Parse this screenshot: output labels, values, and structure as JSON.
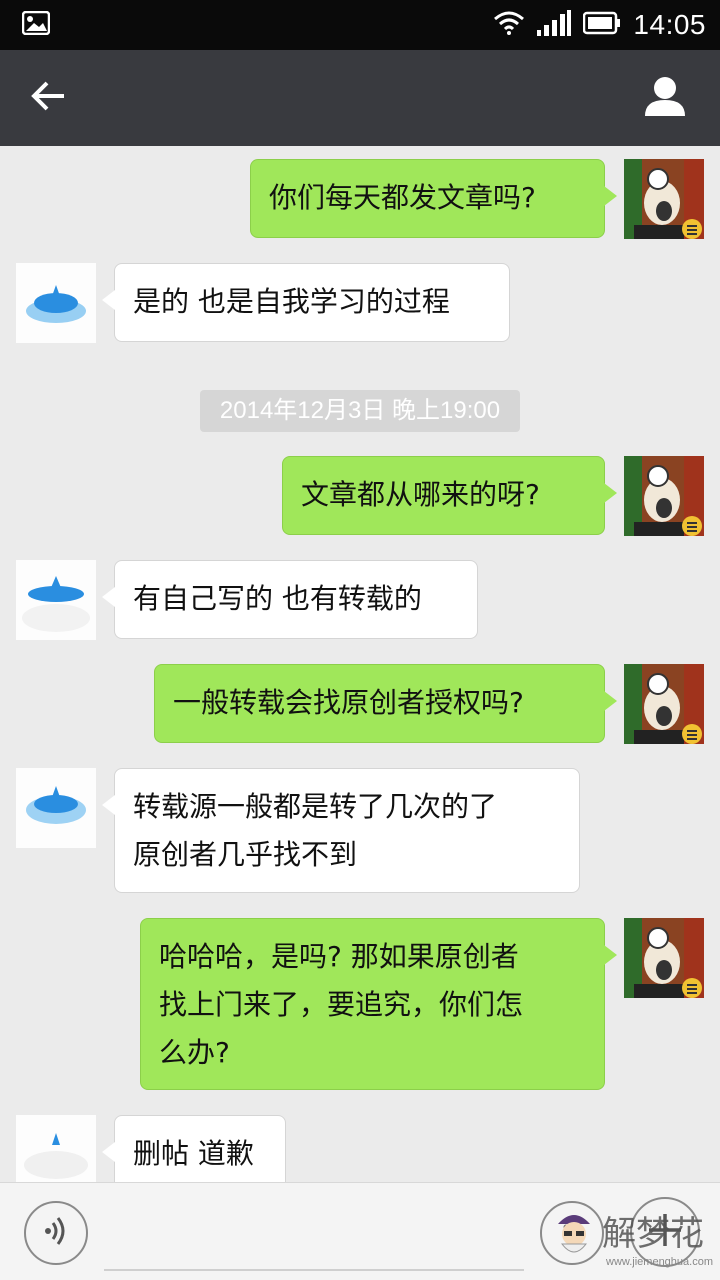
{
  "status_bar": {
    "time": "14:05"
  },
  "title_bar": {
    "back_icon": "arrow-left-icon",
    "profile_icon": "person-icon"
  },
  "messages": [
    {
      "side": "me",
      "text": "你们每天都发文章吗?"
    },
    {
      "side": "them",
      "text": "是的 也是自我学习的过程"
    },
    {
      "side": "me",
      "text": "文章都从哪来的呀?"
    },
    {
      "side": "them",
      "text": "有自己写的 也有转载的"
    },
    {
      "side": "me",
      "text": "一般转载会找原创者授权吗?"
    },
    {
      "side": "them",
      "lines": [
        "转载源一般都是转了几次的了",
        "原创者几乎找不到"
      ]
    },
    {
      "side": "me",
      "lines": [
        "哈哈哈，是吗? 那如果原创者",
        "找上门来了，要追究，你们怎",
        "么办?"
      ]
    },
    {
      "side": "them",
      "text": "删帖 道歉"
    }
  ],
  "timestamp": "2014年12月3日 晚上19:00",
  "input_bar": {
    "voice_icon": "voice-icon",
    "emoji_icon": "emoji-icon",
    "plus_icon": "plus-icon",
    "placeholder": ""
  },
  "watermark": {
    "text": "解梦花",
    "url": "www.jiemenghua.com"
  },
  "colors": {
    "me_bubble": "#a0e75a",
    "them_bubble": "#ffffff",
    "title_bar": "#393a3f",
    "status_bar": "#0a0a0a",
    "chat_bg": "#ebebeb"
  }
}
